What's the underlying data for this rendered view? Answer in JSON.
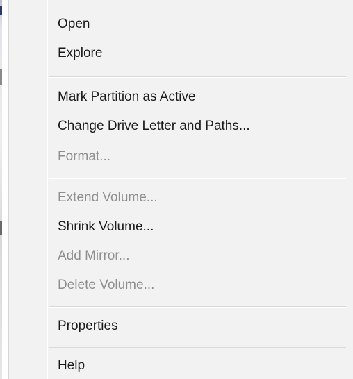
{
  "menu": {
    "items": [
      {
        "label": "Open",
        "enabled": true
      },
      {
        "label": "Explore",
        "enabled": true
      },
      {
        "label": "Mark Partition as Active",
        "enabled": true
      },
      {
        "label": "Change Drive Letter and Paths...",
        "enabled": true
      },
      {
        "label": "Format...",
        "enabled": false
      },
      {
        "label": "Extend Volume...",
        "enabled": false
      },
      {
        "label": "Shrink Volume...",
        "enabled": true
      },
      {
        "label": "Add Mirror...",
        "enabled": false
      },
      {
        "label": "Delete Volume...",
        "enabled": false
      },
      {
        "label": "Properties",
        "enabled": true
      },
      {
        "label": "Help",
        "enabled": true
      }
    ]
  },
  "colors": {
    "menu_background": "#f2f2f2",
    "enabled_text": "#1a1a1a",
    "disabled_text": "#8e8e8e",
    "separator": "#d9d9d9"
  }
}
